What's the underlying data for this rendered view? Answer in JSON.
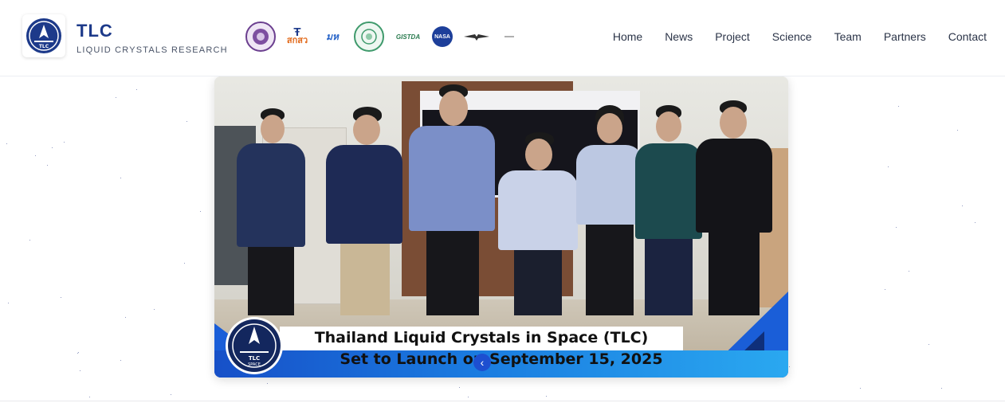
{
  "header": {
    "brand_title": "TLC",
    "brand_subtitle": "LIQUID CRYSTALS RESEARCH",
    "logo_icon": "tlc-space-logo",
    "partner_logos": [
      {
        "name": "university-seal-purple-logo",
        "text": "",
        "color": "#6b3f8f"
      },
      {
        "name": "tsri-logo",
        "text": "สกสว",
        "color": "#e26a1b"
      },
      {
        "name": "mu-logo",
        "text": "มห",
        "color": "#2a66c9"
      },
      {
        "name": "green-seal-logo",
        "text": "",
        "color": "#3f9a6c"
      },
      {
        "name": "gistda-logo",
        "text": "GISTDA",
        "color": "#2a7b4f"
      },
      {
        "name": "nasa-logo",
        "text": "NASA",
        "color": "#1d3f9a"
      },
      {
        "name": "air-force-wings-logo",
        "text": "",
        "color": "#333333"
      },
      {
        "name": "small-faded-logo",
        "text": "",
        "color": "#b0b0b0"
      }
    ],
    "nav": [
      "Home",
      "News",
      "Project",
      "Science",
      "Team",
      "Partners",
      "Contact"
    ]
  },
  "carousel": {
    "caption_line1": "Thailand Liquid Crystals in Space (TLC)",
    "caption_line2": "Set to Launch on September 15, 2025",
    "badge_text": "TLC SPACE",
    "prev_icon": "chevron-left-icon"
  },
  "colors": {
    "brand_blue": "#1d3a8a",
    "accent_blue": "#1a5ed8",
    "nav_text": "#2b3448"
  }
}
